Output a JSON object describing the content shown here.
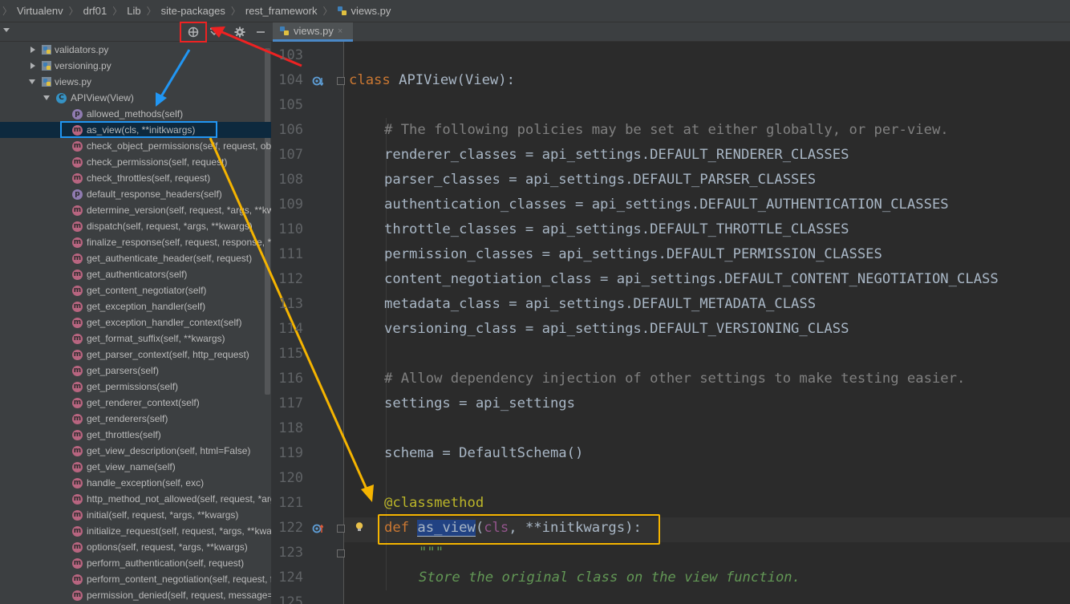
{
  "breadcrumb": [
    "Virtualenv",
    "drf01",
    "Lib",
    "site-packages",
    "rest_framework",
    "views.py"
  ],
  "editor_tab": {
    "label": "views.py",
    "close": "×"
  },
  "structure": {
    "files": [
      {
        "label": "validators.py",
        "expanded": false
      },
      {
        "label": "versioning.py",
        "expanded": false
      },
      {
        "label": "views.py",
        "expanded": true
      }
    ],
    "class_node": {
      "label": "APIView(View)",
      "icon": "C"
    },
    "members": [
      {
        "label": "allowed_methods(self)",
        "kind": "p"
      },
      {
        "label": "as_view(cls, **initkwargs)",
        "kind": "m",
        "selected": true
      },
      {
        "label": "check_object_permissions(self, request, obj)",
        "kind": "m"
      },
      {
        "label": "check_permissions(self, request)",
        "kind": "m"
      },
      {
        "label": "check_throttles(self, request)",
        "kind": "m"
      },
      {
        "label": "default_response_headers(self)",
        "kind": "p"
      },
      {
        "label": "determine_version(self, request, *args, **kwargs)",
        "kind": "m"
      },
      {
        "label": "dispatch(self, request, *args, **kwargs)",
        "kind": "m"
      },
      {
        "label": "finalize_response(self, request, response, *args, **kwargs)",
        "kind": "m"
      },
      {
        "label": "get_authenticate_header(self, request)",
        "kind": "m"
      },
      {
        "label": "get_authenticators(self)",
        "kind": "m"
      },
      {
        "label": "get_content_negotiator(self)",
        "kind": "m"
      },
      {
        "label": "get_exception_handler(self)",
        "kind": "m"
      },
      {
        "label": "get_exception_handler_context(self)",
        "kind": "m"
      },
      {
        "label": "get_format_suffix(self, **kwargs)",
        "kind": "m"
      },
      {
        "label": "get_parser_context(self, http_request)",
        "kind": "m"
      },
      {
        "label": "get_parsers(self)",
        "kind": "m"
      },
      {
        "label": "get_permissions(self)",
        "kind": "m"
      },
      {
        "label": "get_renderer_context(self)",
        "kind": "m"
      },
      {
        "label": "get_renderers(self)",
        "kind": "m"
      },
      {
        "label": "get_throttles(self)",
        "kind": "m"
      },
      {
        "label": "get_view_description(self, html=False)",
        "kind": "m"
      },
      {
        "label": "get_view_name(self)",
        "kind": "m"
      },
      {
        "label": "handle_exception(self, exc)",
        "kind": "m"
      },
      {
        "label": "http_method_not_allowed(self, request, *args, **kwargs)",
        "kind": "m"
      },
      {
        "label": "initial(self, request, *args, **kwargs)",
        "kind": "m"
      },
      {
        "label": "initialize_request(self, request, *args, **kwargs)",
        "kind": "m"
      },
      {
        "label": "options(self, request, *args, **kwargs)",
        "kind": "m"
      },
      {
        "label": "perform_authentication(self, request)",
        "kind": "m"
      },
      {
        "label": "perform_content_negotiation(self, request, force=False)",
        "kind": "m"
      },
      {
        "label": "permission_denied(self, request, message=None, code=None)",
        "kind": "m"
      }
    ]
  },
  "code": {
    "line_numbers": [
      "103",
      "104",
      "105",
      "106",
      "107",
      "108",
      "109",
      "110",
      "111",
      "112",
      "113",
      "114",
      "115",
      "116",
      "117",
      "118",
      "119",
      "120",
      "121",
      "122",
      "123",
      "124",
      "125"
    ],
    "lines": {
      "l104a": "class",
      "l104b": " APIView(View):",
      "l106": "# The following policies may be set at either globally, or per-view.",
      "l107": "renderer_classes = api_settings.DEFAULT_RENDERER_CLASSES",
      "l108": "parser_classes = api_settings.DEFAULT_PARSER_CLASSES",
      "l109": "authentication_classes = api_settings.DEFAULT_AUTHENTICATION_CLASSES",
      "l110": "throttle_classes = api_settings.DEFAULT_THROTTLE_CLASSES",
      "l111": "permission_classes = api_settings.DEFAULT_PERMISSION_CLASSES",
      "l112": "content_negotiation_class = api_settings.DEFAULT_CONTENT_NEGOTIATION_CLASS",
      "l113": "metadata_class = api_settings.DEFAULT_METADATA_CLASS",
      "l114": "versioning_class = api_settings.DEFAULT_VERSIONING_CLASS",
      "l116": "# Allow dependency injection of other settings to make testing easier.",
      "l117": "settings = api_settings",
      "l119": "schema = DefaultSchema()",
      "l121": "@classmethod",
      "l122a": "def",
      "l122b": " ",
      "l122c": "as_view",
      "l122d": "(",
      "l122e": "cls",
      "l122f": ", **initkwargs):",
      "l123": "\"\"\"",
      "l124": "Store the original class on the view function."
    }
  },
  "colors": {
    "annotation_red": "#ee2222",
    "annotation_blue": "#2196f3",
    "annotation_gold": "#f5b400",
    "editor_bg": "#2b2b2b",
    "panel_bg": "#3c3f41"
  }
}
